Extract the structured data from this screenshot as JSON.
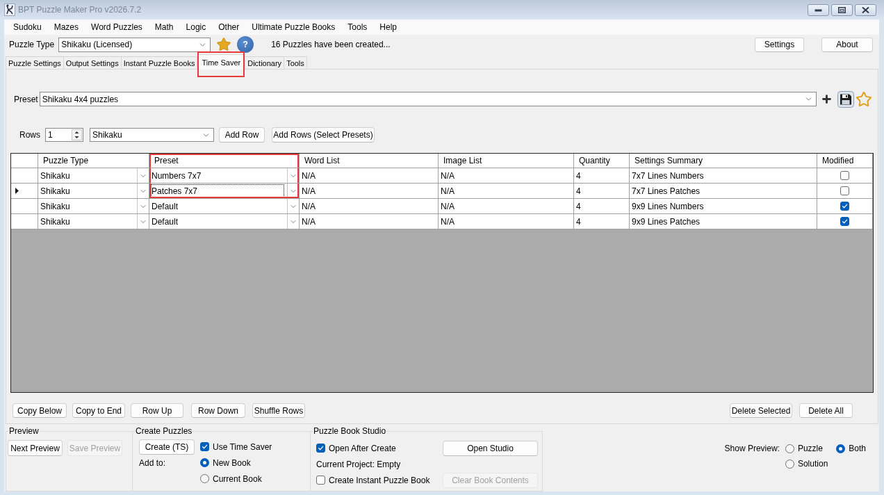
{
  "window": {
    "title": "BPT Puzzle Maker Pro v2026.7.2"
  },
  "menu": [
    "Sudoku",
    "Mazes",
    "Word Puzzles",
    "Math",
    "Logic",
    "Other",
    "Ultimate Puzzle Books",
    "Tools",
    "Help"
  ],
  "toolbar": {
    "puzzle_type_label": "Puzzle Type",
    "puzzle_type": "Shikaku (Licensed)",
    "help_button": "?",
    "status": "16 Puzzles have been created...",
    "buttons": [
      "Settings",
      "About"
    ]
  },
  "tabs": [
    {
      "label": "Puzzle Settings",
      "selected": false,
      "highlighted": false
    },
    {
      "label": "Output Settings",
      "selected": false,
      "highlighted": false
    },
    {
      "label": "Instant Puzzle Books",
      "selected": false,
      "highlighted": false
    },
    {
      "label": "Time Saver",
      "selected": true,
      "highlighted": true
    },
    {
      "label": "Dictionary",
      "selected": false,
      "highlighted": false
    },
    {
      "label": "Tools",
      "selected": false,
      "highlighted": false
    }
  ],
  "time_saver": {
    "preset": {
      "label": "Preset",
      "value": "Shikaku 4x4 puzzles"
    },
    "rows": {
      "label": "Rows",
      "count": "1",
      "puzzle_type": "Shikaku",
      "buttons": [
        "Add Row",
        "Add Rows (Select Presets)"
      ]
    },
    "table": {
      "columns": [
        {
          "label": "Puzzle Type",
          "kind": "combo",
          "highlighted": false
        },
        {
          "label": "Preset",
          "kind": "combo",
          "highlighted": true
        },
        {
          "label": "Word List",
          "kind": "text",
          "highlighted": false
        },
        {
          "label": "Image List",
          "kind": "text",
          "highlighted": false
        },
        {
          "label": "Quantity",
          "kind": "text",
          "highlighted": false
        },
        {
          "label": "Settings Summary",
          "kind": "text",
          "highlighted": false
        },
        {
          "label": "Modified",
          "kind": "check",
          "highlighted": false
        }
      ],
      "rows": [
        {
          "current": false,
          "modified": false,
          "cells": [
            {
              "text": "Shikaku",
              "focused": false,
              "highlighted": false
            },
            {
              "text": "Numbers 7x7",
              "focused": false,
              "highlighted": true
            },
            {
              "text": "N/A",
              "focused": false,
              "highlighted": false
            },
            {
              "text": "N/A",
              "focused": false,
              "highlighted": false
            },
            {
              "text": "4",
              "focused": false,
              "highlighted": false
            },
            {
              "text": "7x7 Lines Numbers",
              "focused": false,
              "highlighted": false
            }
          ]
        },
        {
          "current": true,
          "modified": false,
          "cells": [
            {
              "text": "Shikaku",
              "focused": false,
              "highlighted": false
            },
            {
              "text": "Patches 7x7",
              "focused": true,
              "highlighted": true
            },
            {
              "text": "N/A",
              "focused": false,
              "highlighted": false
            },
            {
              "text": "N/A",
              "focused": false,
              "highlighted": false
            },
            {
              "text": "4",
              "focused": false,
              "highlighted": false
            },
            {
              "text": "7x7 Lines Patches",
              "focused": false,
              "highlighted": false
            }
          ]
        },
        {
          "current": false,
          "modified": true,
          "cells": [
            {
              "text": "Shikaku",
              "focused": false,
              "highlighted": false
            },
            {
              "text": "Default",
              "focused": false,
              "highlighted": false
            },
            {
              "text": "N/A",
              "focused": false,
              "highlighted": false
            },
            {
              "text": "N/A",
              "focused": false,
              "highlighted": false
            },
            {
              "text": "4",
              "focused": false,
              "highlighted": false
            },
            {
              "text": "9x9 Lines Numbers",
              "focused": false,
              "highlighted": false
            }
          ]
        },
        {
          "current": false,
          "modified": true,
          "cells": [
            {
              "text": "Shikaku",
              "focused": false,
              "highlighted": false
            },
            {
              "text": "Default",
              "focused": false,
              "highlighted": false
            },
            {
              "text": "N/A",
              "focused": false,
              "highlighted": false
            },
            {
              "text": "N/A",
              "focused": false,
              "highlighted": false
            },
            {
              "text": "4",
              "focused": false,
              "highlighted": false
            },
            {
              "text": "9x9 Lines Patches",
              "focused": false,
              "highlighted": false
            }
          ]
        }
      ]
    },
    "row_buttons": [
      "Copy Below",
      "Copy to End",
      "Row Up",
      "Row Down",
      "Shuffle Rows"
    ],
    "delete_buttons": [
      "Delete Selected",
      "Delete All"
    ]
  },
  "preview": {
    "title": "Preview",
    "buttons": [
      {
        "label": "Next Preview",
        "disabled": false
      },
      {
        "label": "Save Preview",
        "disabled": true
      }
    ]
  },
  "create_puzzles": {
    "title": "Create Puzzles",
    "create_button": "Create (TS)",
    "use_time_saver": {
      "label": "Use Time Saver",
      "checked": true
    },
    "add_to_label": "Add to:",
    "add_to": [
      {
        "label": "New Book",
        "selected": true
      },
      {
        "label": "Current Book",
        "selected": false
      }
    ]
  },
  "puzzle_book_studio": {
    "title": "Puzzle Book Studio",
    "open_after_create": {
      "label": "Open After Create",
      "checked": true
    },
    "current_project": "Current Project: Empty",
    "create_instant_book": {
      "label": "Create Instant Puzzle Book",
      "checked": false
    },
    "buttons": [
      {
        "label": "Open Studio",
        "disabled": false
      },
      {
        "label": "Clear Book Contents",
        "disabled": true
      }
    ]
  },
  "show_preview": {
    "label": "Show Preview:",
    "options": [
      {
        "label": "Puzzle",
        "selected": false
      },
      {
        "label": "Both",
        "selected": true
      },
      {
        "label": "Solution",
        "selected": false
      }
    ]
  }
}
